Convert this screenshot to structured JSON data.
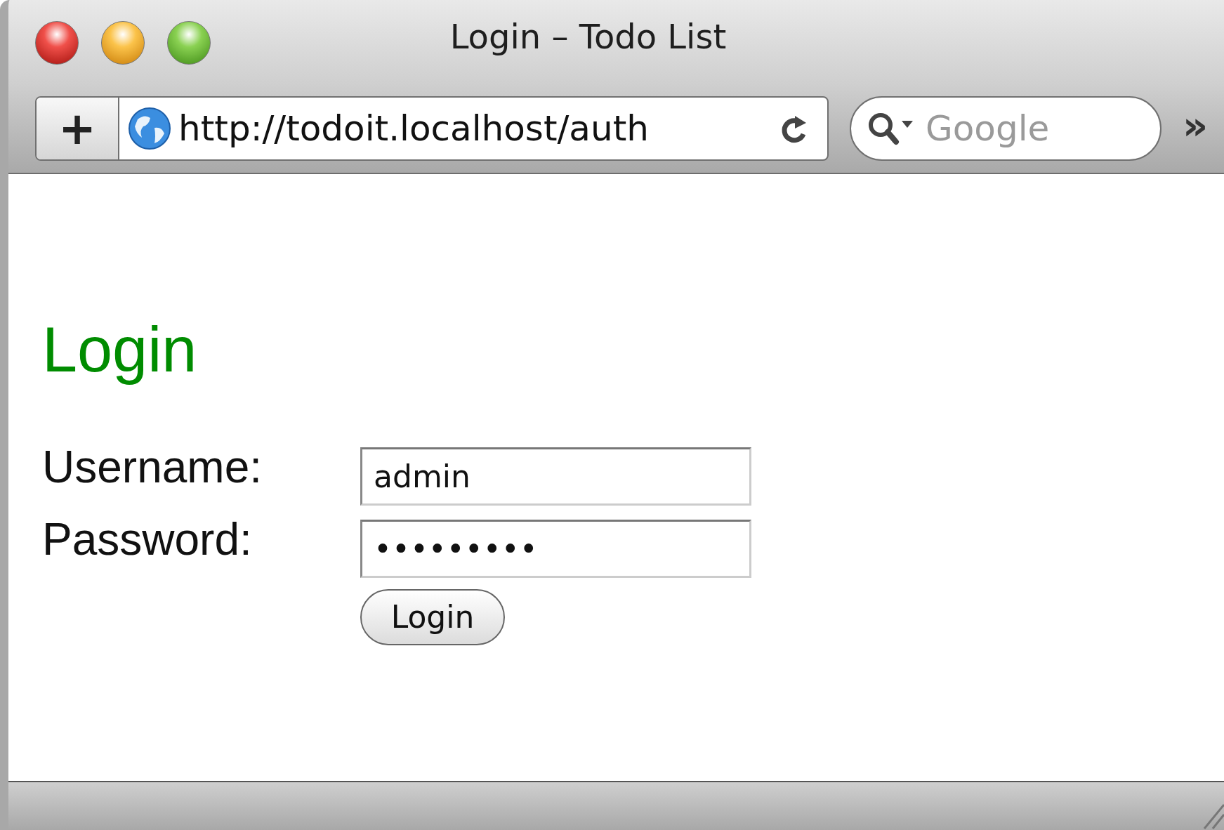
{
  "window": {
    "title": "Login – Todo List"
  },
  "toolbar": {
    "add_button": "+",
    "url": "http://todoit.localhost/auth",
    "search": {
      "placeholder": "Google"
    },
    "overflow": "»"
  },
  "page": {
    "heading": "Login",
    "fields": [
      {
        "label": "Username:",
        "value": "admin"
      },
      {
        "label": "Password:",
        "value": "•••••••••"
      }
    ],
    "button": "Login"
  }
}
